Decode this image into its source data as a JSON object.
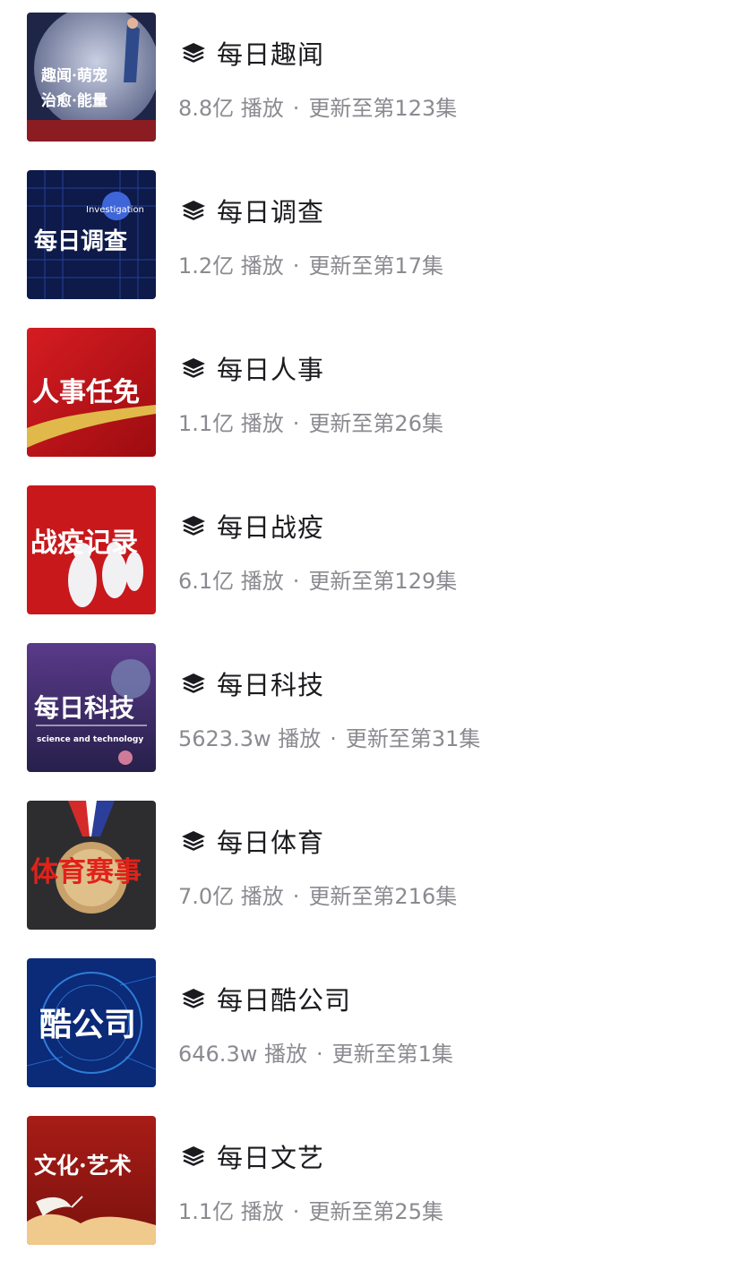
{
  "items": [
    {
      "title": "每日趣闻",
      "plays": "8.8亿 播放",
      "update": "更新至第123集",
      "cover": {
        "lines": [
          "趣闻·萌宠",
          "治愈·能量"
        ],
        "sub": "",
        "bg": "#1f2546"
      }
    },
    {
      "title": "每日调查",
      "plays": "1.2亿 播放",
      "update": "更新至第17集",
      "cover": {
        "lines": [
          "每日调查"
        ],
        "sub": "Investigation",
        "bg": "#0d1a4a"
      }
    },
    {
      "title": "每日人事",
      "plays": "1.1亿 播放",
      "update": "更新至第26集",
      "cover": {
        "lines": [
          "人事任免"
        ],
        "sub": "",
        "bg": "#c9141a"
      }
    },
    {
      "title": "每日战疫",
      "plays": "6.1亿 播放",
      "update": "更新至第129集",
      "cover": {
        "lines": [
          "战疫记录"
        ],
        "sub": "",
        "bg": "#c8181c"
      }
    },
    {
      "title": "每日科技",
      "plays": "5623.3w 播放",
      "update": "更新至第31集",
      "cover": {
        "lines": [
          "每日科技"
        ],
        "sub": "science and technology",
        "bg": "#3a2a66"
      }
    },
    {
      "title": "每日体育",
      "plays": "7.0亿 播放",
      "update": "更新至第216集",
      "cover": {
        "lines": [
          "体育赛事"
        ],
        "sub": "",
        "bg": "#2d2d2f"
      }
    },
    {
      "title": "每日酷公司",
      "plays": "646.3w 播放",
      "update": "更新至第1集",
      "cover": {
        "lines": [
          "酷公司"
        ],
        "sub": "",
        "bg": "#0b2a78"
      }
    },
    {
      "title": "每日文艺",
      "plays": "1.1亿 播放",
      "update": "更新至第25集",
      "cover": {
        "lines": [
          "文化·艺术"
        ],
        "sub": "",
        "bg": "#9e1a14"
      }
    }
  ],
  "separator": "·",
  "icons": {
    "title_icon": "layers-icon"
  },
  "colors": {
    "title": "#1b1b1f",
    "meta": "#8a8a90"
  }
}
